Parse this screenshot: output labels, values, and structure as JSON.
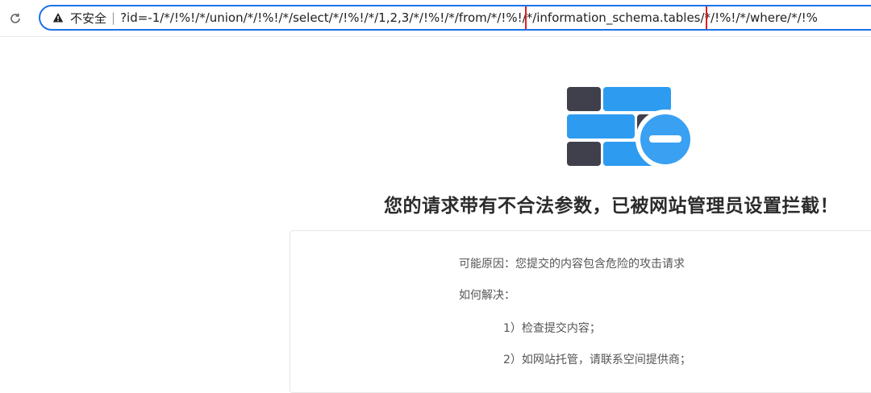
{
  "browser": {
    "security_label": "不安全",
    "separator": "|",
    "url_prefix": "?id=-1/*/!%!/*/union/*/!%!/*/select/*/!%!/*/1,2,3/*/!%!/*/from/*/!%!/",
    "url_highlight": "*/information_schema.tables/",
    "url_suffix": "*/!%!/*/where/*/!%",
    "highlight_color": "#e02020",
    "omnibox_border_color": "#1a73e8"
  },
  "block_page": {
    "title": "您的请求带有不合法参数，已被网站管理员设置拦截！",
    "reason": "可能原因：您提交的内容包含危险的攻击请求",
    "how_to_solve": "如何解决：",
    "steps": [
      "1）检查提交内容；",
      "2）如网站托管，请联系空间提供商；"
    ],
    "icon": "firewall-blocked-icon",
    "colors": {
      "brick_blue": "#2d9cf0",
      "brick_dark": "#3f404c",
      "badge_fill": "#3aa0f2",
      "badge_minus": "#ffffff"
    }
  }
}
